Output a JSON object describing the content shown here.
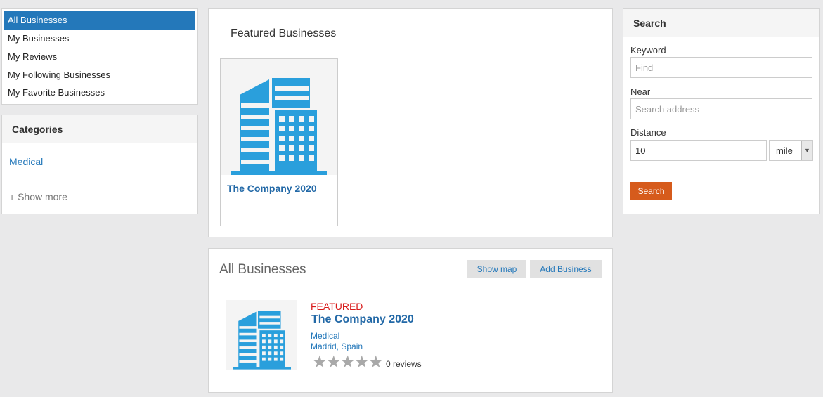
{
  "nav": {
    "items": [
      {
        "label": "All Businesses",
        "active": true
      },
      {
        "label": "My Businesses"
      },
      {
        "label": "My Reviews"
      },
      {
        "label": "My Following Businesses"
      },
      {
        "label": "My Favorite Businesses"
      }
    ]
  },
  "categories": {
    "title": "Categories",
    "items": [
      "Medical"
    ],
    "show_more": "+ Show more"
  },
  "featured": {
    "title": "Featured Businesses",
    "card": {
      "name": "The Company 2020",
      "icon": "office-building-icon"
    }
  },
  "all_businesses": {
    "title": "All Businesses",
    "show_map": "Show map",
    "add_business": "Add Business",
    "listing": {
      "tag": "FEATURED",
      "name": "The Company 2020",
      "category": "Medical",
      "location": "Madrid, Spain",
      "rating": 0,
      "reviews": "0 reviews"
    }
  },
  "search": {
    "title": "Search",
    "keyword_label": "Keyword",
    "keyword_placeholder": "Find",
    "near_label": "Near",
    "near_placeholder": "Search address",
    "distance_label": "Distance",
    "distance_value": "10",
    "unit": "mile",
    "button": "Search"
  },
  "colors": {
    "accent": "#2478ba",
    "featured_tag": "#d81a1a",
    "search_button": "#d65b1c",
    "building": "#2a9fdc"
  }
}
